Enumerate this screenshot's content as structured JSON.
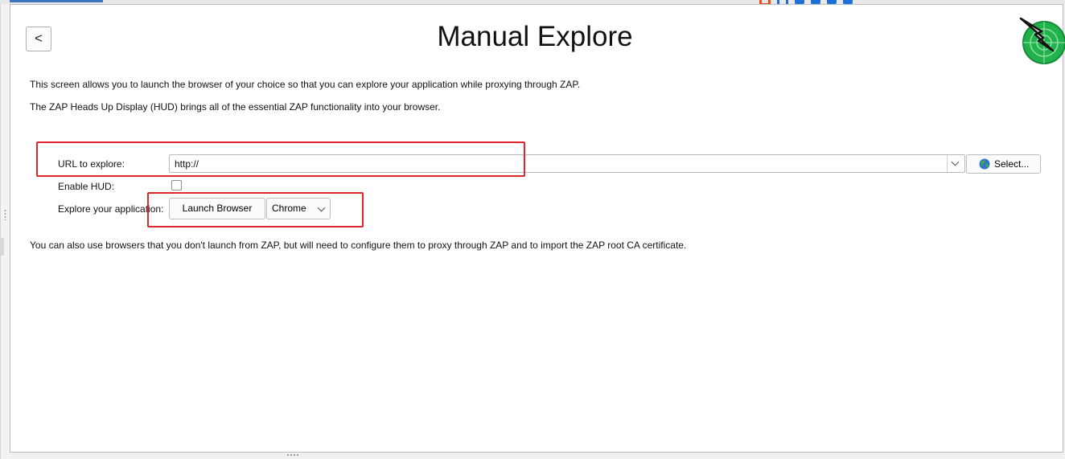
{
  "header": {
    "back_label": "<",
    "title": "Manual Explore",
    "logo_icon": "zap-logo-icon"
  },
  "description": {
    "line1": "This screen allows you to launch the browser of your choice so that you can explore your application while proxying through ZAP.",
    "line2": "The ZAP Heads Up Display (HUD) brings all of the essential ZAP functionality into your browser.",
    "line3": "You can also use browsers that you don't launch from ZAP, but will need to configure them to proxy through ZAP and to import the ZAP root CA certificate."
  },
  "form": {
    "url_label": "URL to explore:",
    "url_value": "http://",
    "select_button_label": "Select...",
    "select_icon": "globe-icon",
    "hud_label": "Enable HUD:",
    "hud_checked": false,
    "explore_label": "Explore your application:",
    "launch_button_label": "Launch Browser",
    "browser_selected": "Chrome"
  },
  "colors": {
    "annotation": "#e0262a",
    "accent": "#3b78c4",
    "logo_green": "#22b24c"
  }
}
